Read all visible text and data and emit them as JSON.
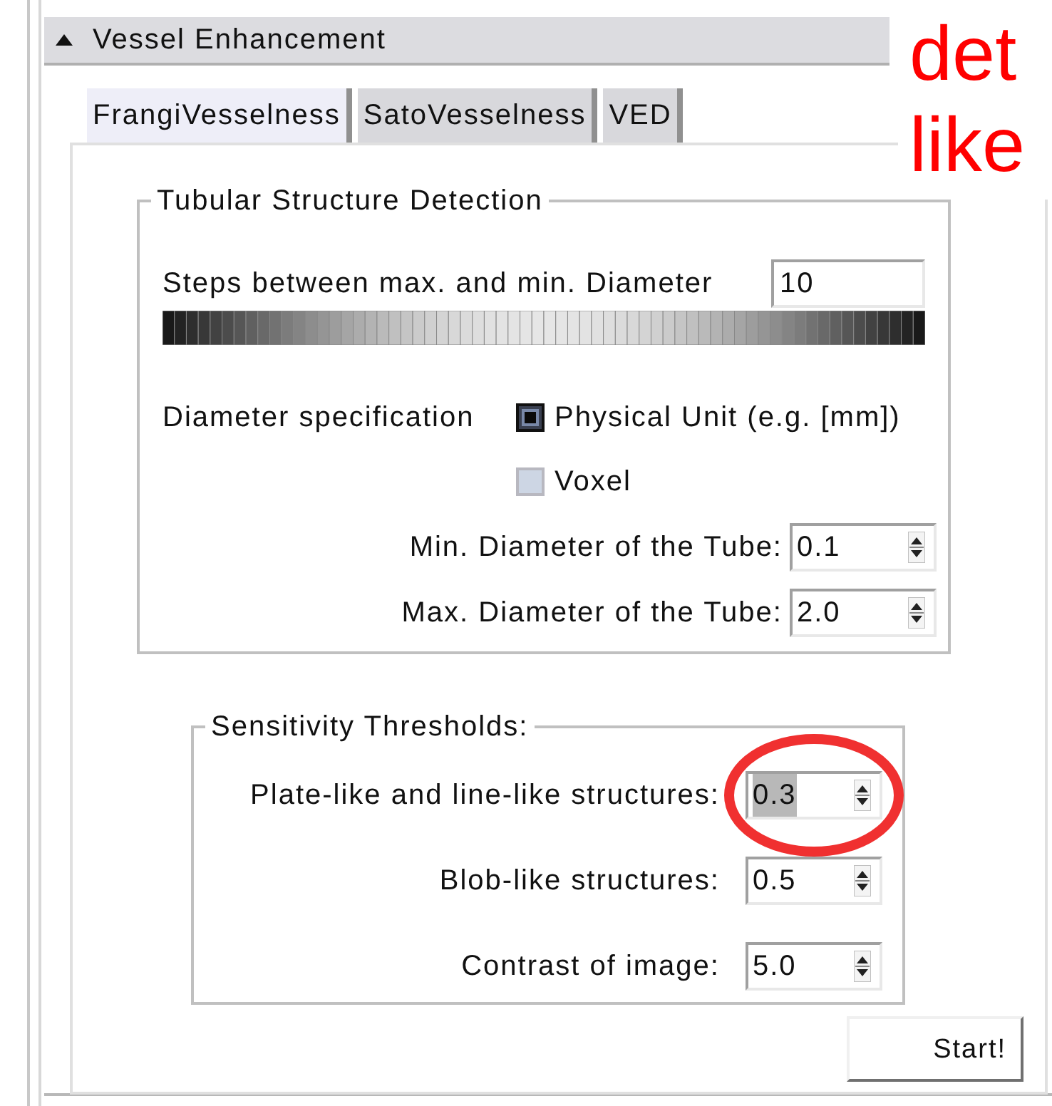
{
  "panel": {
    "title": "Vessel Enhancement",
    "expanded": true
  },
  "tabs": [
    {
      "label": "FrangiVesselness",
      "selected": true
    },
    {
      "label": "SatoVesselness",
      "selected": false
    },
    {
      "label": "VED",
      "selected": false
    }
  ],
  "tubular": {
    "title": "Tubular Structure Detection",
    "steps_label": "Steps between max. and min. Diameter",
    "steps_value": "10",
    "diameter_label": "Diameter specification",
    "options": [
      {
        "label": "Physical Unit (e.g. [mm])",
        "checked": true
      },
      {
        "label": "Voxel",
        "checked": false
      }
    ],
    "fields": [
      {
        "label": "Min. Diameter of the Tube:",
        "value": "0.1",
        "text_selected": false
      },
      {
        "label": "Max. Diameter of the Tube:",
        "value": "2.0",
        "text_selected": false
      }
    ]
  },
  "sensitivity": {
    "title": "Sensitivity Thresholds:",
    "fields": [
      {
        "label": "Plate-like and line-like structures:",
        "value": "0.3",
        "text_selected": true,
        "annotated": true
      },
      {
        "label": "Blob-like structures:",
        "value": "0.5",
        "text_selected": false,
        "annotated": false
      },
      {
        "label": "Contrast of image:",
        "value": "5.0",
        "text_selected": false,
        "annotated": false
      }
    ]
  },
  "start_button": "Start!",
  "annotation": {
    "lines": [
      "det",
      "like"
    ]
  }
}
